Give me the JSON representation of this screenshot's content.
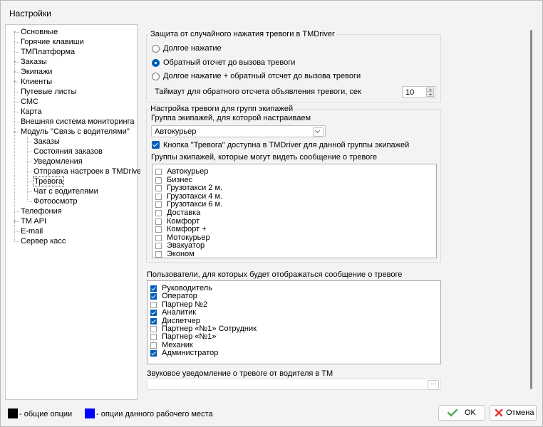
{
  "window": {
    "title": "Настройки"
  },
  "tree": {
    "items": [
      {
        "label": "Основные",
        "level": 0,
        "expandable": true
      },
      {
        "label": "Горячие клавиши",
        "level": 0,
        "expandable": false
      },
      {
        "label": "TMПлатформа",
        "level": 0,
        "expandable": false
      },
      {
        "label": "Заказы",
        "level": 0,
        "expandable": true
      },
      {
        "label": "Экипажи",
        "level": 0,
        "expandable": true
      },
      {
        "label": "Клиенты",
        "level": 0,
        "expandable": true
      },
      {
        "label": "Путевые листы",
        "level": 0,
        "expandable": false
      },
      {
        "label": "СМС",
        "level": 0,
        "expandable": false
      },
      {
        "label": "Карта",
        "level": 0,
        "expandable": false
      },
      {
        "label": "Внешняя система мониторинга",
        "level": 0,
        "expandable": false
      },
      {
        "label": "Модуль \"Связь с водителями\"",
        "level": 0,
        "expandable": true,
        "expanded": true
      },
      {
        "label": "Заказы",
        "level": 1
      },
      {
        "label": "Состояния заказов",
        "level": 1
      },
      {
        "label": "Уведомления",
        "level": 1
      },
      {
        "label": "Отправка настроек в TMDriver",
        "level": 1
      },
      {
        "label": "Тревога",
        "level": 1,
        "selected": true
      },
      {
        "label": "Чат с водителями",
        "level": 1
      },
      {
        "label": "Фотоосмотр",
        "level": 1
      },
      {
        "label": "Телефония",
        "level": 0,
        "expandable": false
      },
      {
        "label": "TM API",
        "level": 0,
        "expandable": true
      },
      {
        "label": "E-mail",
        "level": 0,
        "expandable": false
      },
      {
        "label": "Сервер касс",
        "level": 0,
        "expandable": false
      }
    ]
  },
  "protection": {
    "legend": "Защита от случайного нажатия тревоги в TMDriver",
    "options": [
      {
        "label": "Долгое нажатие",
        "selected": false
      },
      {
        "label": "Обратный отсчет до вызова тревоги",
        "selected": true
      },
      {
        "label": "Долгое нажатие + обратный отсчет до вызова тревоги",
        "selected": false
      }
    ],
    "timeout_label": "Таймаут для обратного отсчета объявления тревоги, сек",
    "timeout_value": "10"
  },
  "crew_settings": {
    "legend": "Настройка тревоги для групп экипажей",
    "group_label": "Группа экипажей, для которой настраиваем",
    "group_value": "Автокурьер",
    "button_checkbox_label": "Кнопка \"Тревога\" доступна  в TMDriver для данной группы экипажей",
    "button_checkbox_checked": true,
    "visible_groups_label": "Группы экипажей, которые могут видеть сообщение о тревоге",
    "groups": [
      {
        "label": "Автокурьер",
        "checked": false
      },
      {
        "label": "Бизнес",
        "checked": false
      },
      {
        "label": "Грузотакси 2 м.",
        "checked": false
      },
      {
        "label": "Грузотакси 4 м.",
        "checked": false
      },
      {
        "label": "Грузотакси 6 м.",
        "checked": false
      },
      {
        "label": "Доставка",
        "checked": false
      },
      {
        "label": "Комфорт",
        "checked": false
      },
      {
        "label": "Комфорт +",
        "checked": false
      },
      {
        "label": "Мотокурьер",
        "checked": false
      },
      {
        "label": "Эвакуатор",
        "checked": false
      },
      {
        "label": "Эконом",
        "checked": false
      }
    ]
  },
  "users": {
    "label": "Пользователи, для которых будет отображаться сообщение о тревоге",
    "items": [
      {
        "label": "Руководитель",
        "checked": true
      },
      {
        "label": "Оператор",
        "checked": true
      },
      {
        "label": "Партнер №2",
        "checked": false
      },
      {
        "label": "Аналитик",
        "checked": true
      },
      {
        "label": "Диспетчер",
        "checked": true
      },
      {
        "label": "Партнер «№1» Сотрудник",
        "checked": false
      },
      {
        "label": "Партнер «№1»",
        "checked": false
      },
      {
        "label": "Механик",
        "checked": false
      },
      {
        "label": "Администратор",
        "checked": true
      }
    ]
  },
  "sound": {
    "label": "Звуковое уведомление о тревоге от водителя в ТМ",
    "value": "",
    "button_label": "···"
  },
  "footer": {
    "legend_general_label": "- общие опции",
    "legend_general_color": "#000000",
    "legend_workplace_label": "- опции данного рабочего места",
    "legend_workplace_color": "#0000ff",
    "ok_label": "OK",
    "cancel_label": "Отмена",
    "ok_icon_color": "#4caf50",
    "cancel_icon_color": "#e53935"
  }
}
